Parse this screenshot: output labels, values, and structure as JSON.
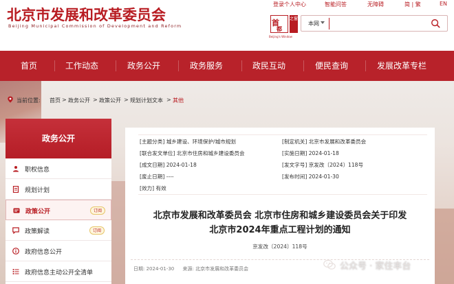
{
  "header": {
    "site_title": "北京市发展和改革委员会",
    "site_subtitle": "Beijing Municipal Commission of Development and Reform",
    "top_links": [
      "登录个人中心",
      "智能问答",
      "无障碍",
      "简 | 繁",
      "EN"
    ],
    "logo_char_top": "首",
    "logo_char_bottom": "都",
    "logo_seal": "之窗",
    "logo_caption": "Beijing's Window",
    "search": {
      "scope": "本网",
      "value": "",
      "placeholder": ""
    }
  },
  "nav": {
    "items": [
      "首页",
      "工作动态",
      "政务公开",
      "政务服务",
      "政民互动",
      "便民查询",
      "发展改革专栏"
    ]
  },
  "breadcrumb": {
    "label": "当前位置:",
    "items": [
      "首页",
      "政务公开",
      "政策公开",
      "规划计划文本",
      "其他"
    ],
    "separator": ">"
  },
  "sidebar": {
    "title": "政务公开",
    "items": [
      {
        "label": "职权信息",
        "badge": ""
      },
      {
        "label": "规划计划",
        "badge": ""
      },
      {
        "label": "政策公开",
        "badge": "订阅"
      },
      {
        "label": "政策解读",
        "badge": "订阅"
      },
      {
        "label": "政府信息公开",
        "badge": ""
      },
      {
        "label": "政府信息主动公开全清单",
        "badge": ""
      }
    ]
  },
  "document": {
    "meta": {
      "topic": "[主题分类] 城乡建设、环境保护/城市规划",
      "issuer": "[制定机关] 北京市发展和改革委员会",
      "joint": "[联合发文单位] 北京市住房和城乡建设委员会",
      "effective": "[实施日期] 2024-01-18",
      "created": "[成文日期] 2024-01-18",
      "doc_no": "[发文字号] 京发改〔2024〕118号",
      "abolished": "[废止日期] ----",
      "published": "[发布时间] 2024-01-30",
      "validity": "[效力] 有效"
    },
    "title_line1": "北京市发展和改革委员会 北京市住房和城乡建设委员会关于印发",
    "title_line2": "北京市2024年重点工程计划的通知",
    "number": "京发改〔2024〕118号",
    "footer_date": "日期: 2024-01-30",
    "footer_source": "来源: 北京市发展和改革委员会"
  },
  "watermark": {
    "text": "公众号 · 家住丰台"
  },
  "colors": {
    "brand_red": "#b8222a",
    "badge_bg": "#fff6dd"
  }
}
